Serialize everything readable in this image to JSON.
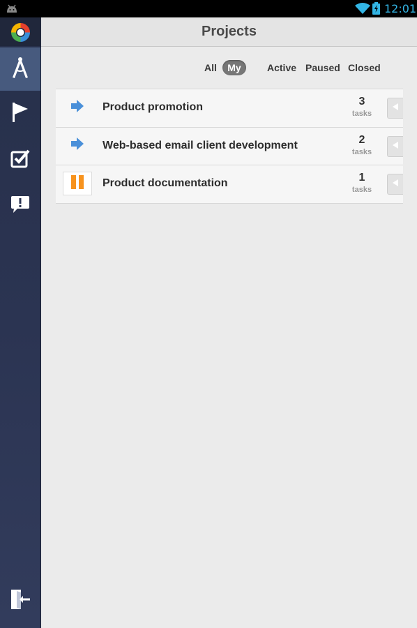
{
  "statusbar": {
    "time": "12:01"
  },
  "header": {
    "title": "Projects"
  },
  "filters": {
    "all": "All",
    "my": "My",
    "active": "Active",
    "paused": "Paused",
    "closed": "Closed",
    "selected": "My"
  },
  "sidebar": {
    "items": [
      {
        "name": "projects",
        "icon": "compass-icon",
        "active": true
      },
      {
        "name": "milestones",
        "icon": "flag-icon",
        "active": false
      },
      {
        "name": "tasks",
        "icon": "checkbox-icon",
        "active": false
      },
      {
        "name": "discussions",
        "icon": "speech-bubble-exclamation-icon",
        "active": false
      },
      {
        "name": "logout",
        "icon": "logout-door-icon",
        "active": false
      }
    ]
  },
  "projects": [
    {
      "name": "Product promotion",
      "count": "3",
      "unit": "tasks",
      "status_icon": "blue-arrow-icon"
    },
    {
      "name": "Web-based email client development",
      "count": "2",
      "unit": "tasks",
      "status_icon": "blue-arrow-icon"
    },
    {
      "name": "Product documentation",
      "count": "1",
      "unit": "tasks",
      "status_icon": "orange-pause-icon"
    }
  ],
  "colors": {
    "clock": "#33b5e5",
    "arrow": "#4a90d9",
    "pause": "#f7931e",
    "sidebar_active": "#475a7e",
    "filter_selected": "#777777"
  }
}
